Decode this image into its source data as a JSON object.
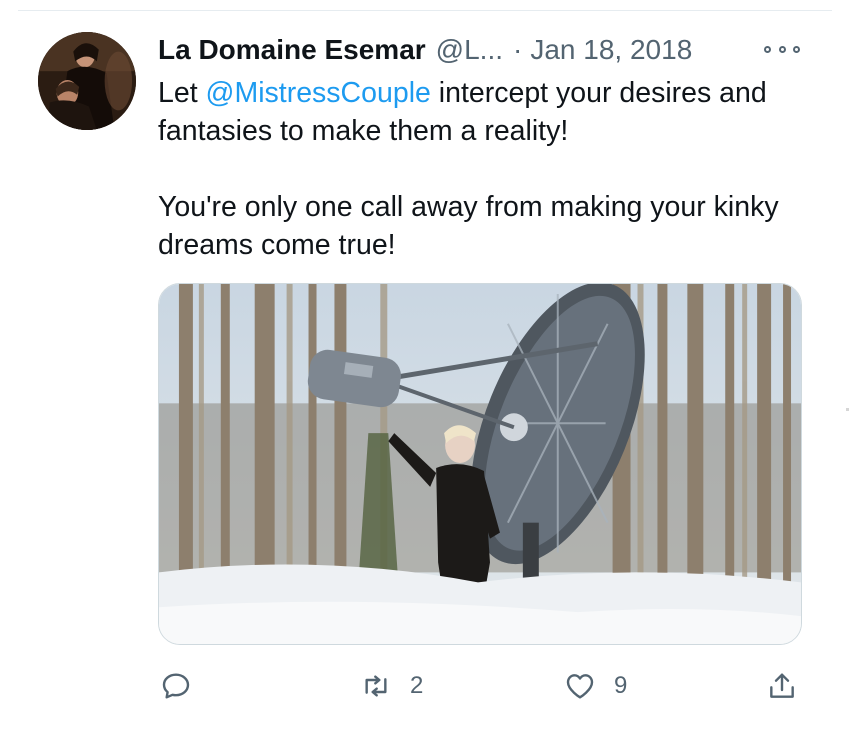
{
  "tweet": {
    "author_name": "La Domaine Esemar",
    "author_handle": "@L...",
    "separator": "·",
    "date": "Jan 18, 2018",
    "text_prefix": "Let ",
    "mention": "@MistressCouple",
    "text_line1_rest": " intercept your desires and fantasies to make them a reality!",
    "text_paragraph2": "You're only one call away from making your kinky dreams come true!"
  },
  "actions": {
    "reply": {
      "icon": "reply-icon",
      "count": ""
    },
    "retweet": {
      "icon": "retweet-icon",
      "count": "2"
    },
    "like": {
      "icon": "heart-icon",
      "count": "9"
    },
    "share": {
      "icon": "share-icon"
    }
  },
  "colors": {
    "text": "#0f1419",
    "secondary": "#536471",
    "link": "#1d9bf0",
    "divider": "#e6ecf0"
  }
}
